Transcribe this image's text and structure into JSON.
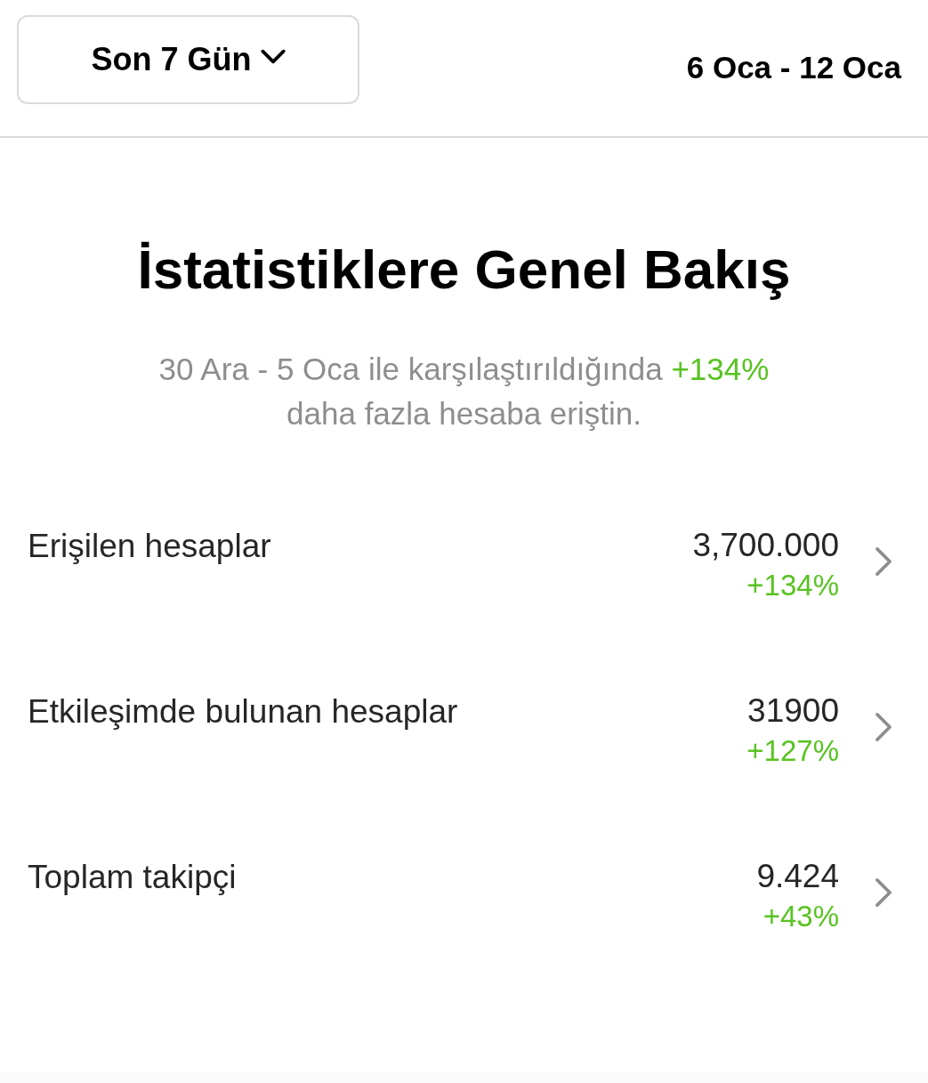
{
  "header": {
    "period_dropdown": {
      "label": "Son 7 Gün"
    },
    "date_range": "6 Oca - 12 Oca"
  },
  "overview": {
    "title": "İstatistiklere Genel Bakış",
    "comparison": {
      "before": "30 Ara - 5 Oca ile karşılaştırıldığında",
      "change": "+134%",
      "after": "daha fazla hesaba eriştin."
    }
  },
  "metrics": [
    {
      "label": "Erişilen hesaplar",
      "value": "3,700.000",
      "change": "+134%"
    },
    {
      "label": "Etkileşimde bulunan hesaplar",
      "value": "31900",
      "change": "+127%"
    },
    {
      "label": "Toplam takipçi",
      "value": "9.424",
      "change": "+43%"
    }
  ]
}
